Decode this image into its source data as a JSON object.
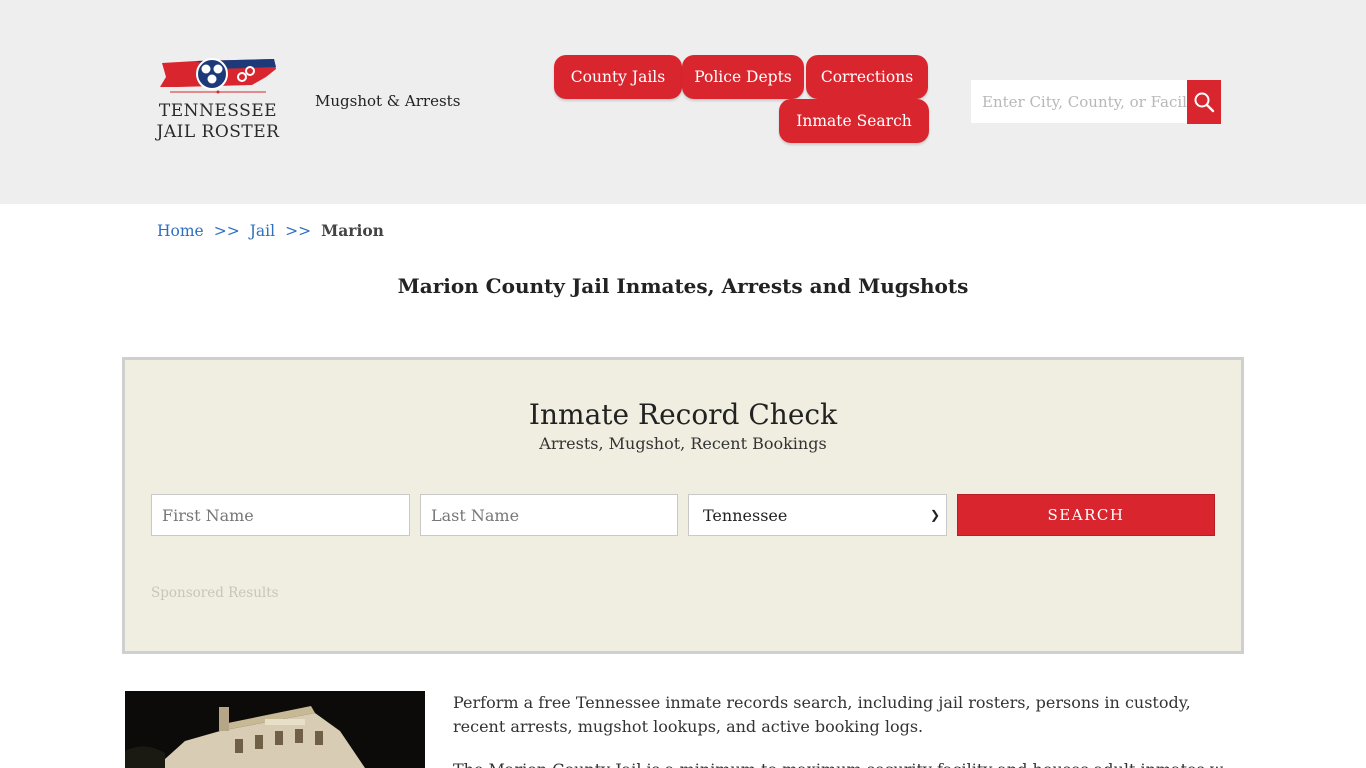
{
  "header": {
    "logo": {
      "line1": "TENNESSEE",
      "line2": "JAIL ROSTER"
    },
    "tagline": "Mugshot & Arrests",
    "nav": [
      {
        "label": "County Jails"
      },
      {
        "label": "Police Depts"
      },
      {
        "label": "Corrections"
      },
      {
        "label": "Inmate Search"
      }
    ],
    "search": {
      "placeholder": "Enter City, County, or Facility"
    }
  },
  "breadcrumb": {
    "items": [
      "Home",
      "Jail"
    ],
    "separator": ">>",
    "current": "Marion"
  },
  "page_title": "Marion County Jail Inmates, Arrests and Mugshots",
  "record_check": {
    "title": "Inmate Record Check",
    "subtitle": "Arrests, Mugshot, Recent Bookings",
    "first_name_placeholder": "First Name",
    "last_name_placeholder": "Last Name",
    "state_selected": "Tennessee",
    "submit_label": "SEARCH",
    "sponsored": "Sponsored Results"
  },
  "content": {
    "intro": "Perform a free Tennessee inmate records search, including jail rosters, persons in custody, recent arrests, mugshot lookups, and active booking logs.",
    "para2_partial": "The Marion County Jail is a minimum to maximum security facility and houses adult inmates who've"
  },
  "colors": {
    "brand_red": "#d9262e",
    "header_bg": "#efeeee",
    "panel_bg": "#f0eee0",
    "link_blue": "#2f6fbf"
  }
}
